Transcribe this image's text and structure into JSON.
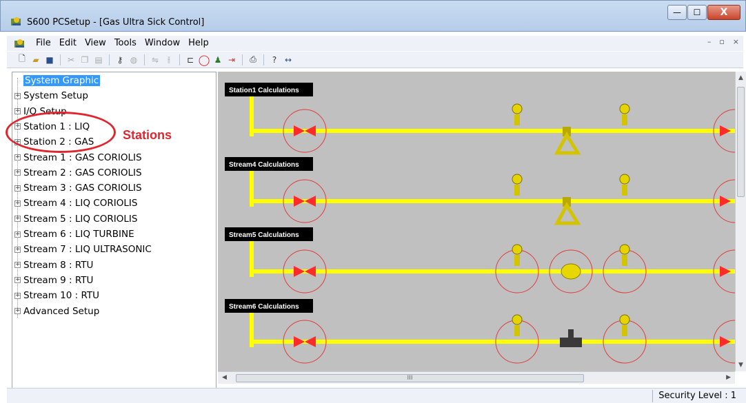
{
  "window": {
    "title": "S600 PCSetup  - [Gas Ultra Sick Control]",
    "minimize": "—",
    "maximize": "☐",
    "close": "X"
  },
  "menu": {
    "items": [
      "File",
      "Edit",
      "View",
      "Tools",
      "Window",
      "Help"
    ],
    "mdi_minimize": "–",
    "mdi_restore": "▫",
    "mdi_close": "×"
  },
  "tree": {
    "items": [
      {
        "label": "System Graphic",
        "selected": true,
        "expandable": false
      },
      {
        "label": "System Setup",
        "expandable": true
      },
      {
        "label": "I/O Setup",
        "expandable": true
      },
      {
        "label": "Station 1 : LIQ",
        "expandable": true
      },
      {
        "label": "Station 2 : GAS",
        "expandable": true
      },
      {
        "label": "Stream 1 : GAS CORIOLIS",
        "expandable": true
      },
      {
        "label": "Stream 2 : GAS CORIOLIS",
        "expandable": true
      },
      {
        "label": "Stream 3 : GAS CORIOLIS",
        "expandable": true
      },
      {
        "label": "Stream 4 : LIQ CORIOLIS",
        "expandable": true
      },
      {
        "label": "Stream 5 : LIQ CORIOLIS",
        "expandable": true
      },
      {
        "label": "Stream 6 : LIQ TURBINE",
        "expandable": true
      },
      {
        "label": "Stream 7 : LIQ ULTRASONIC",
        "expandable": true
      },
      {
        "label": "Stream 8 : RTU",
        "expandable": true
      },
      {
        "label": "Stream 9 : RTU",
        "expandable": true
      },
      {
        "label": "Stream 10 : RTU",
        "expandable": true
      },
      {
        "label": "Advanced Setup",
        "expandable": true
      }
    ]
  },
  "annotation": {
    "text": "Stations",
    "color": "#e0262c"
  },
  "graphic": {
    "background": "#c0c0c0",
    "pipe_color": "#ffff00",
    "valve_color": "#ff2a2a",
    "rows": [
      {
        "label": "Station1 Calculations",
        "meter": "coriolis"
      },
      {
        "label": "Stream4 Calculations",
        "meter": "coriolis"
      },
      {
        "label": "Stream5 Calculations",
        "meter": "turbine"
      },
      {
        "label": "Stream6 Calculations",
        "meter": "ultrasonic"
      }
    ]
  },
  "hscroll": {
    "thumb_text": "III"
  },
  "status": {
    "security_level": "Security Level : 1"
  }
}
